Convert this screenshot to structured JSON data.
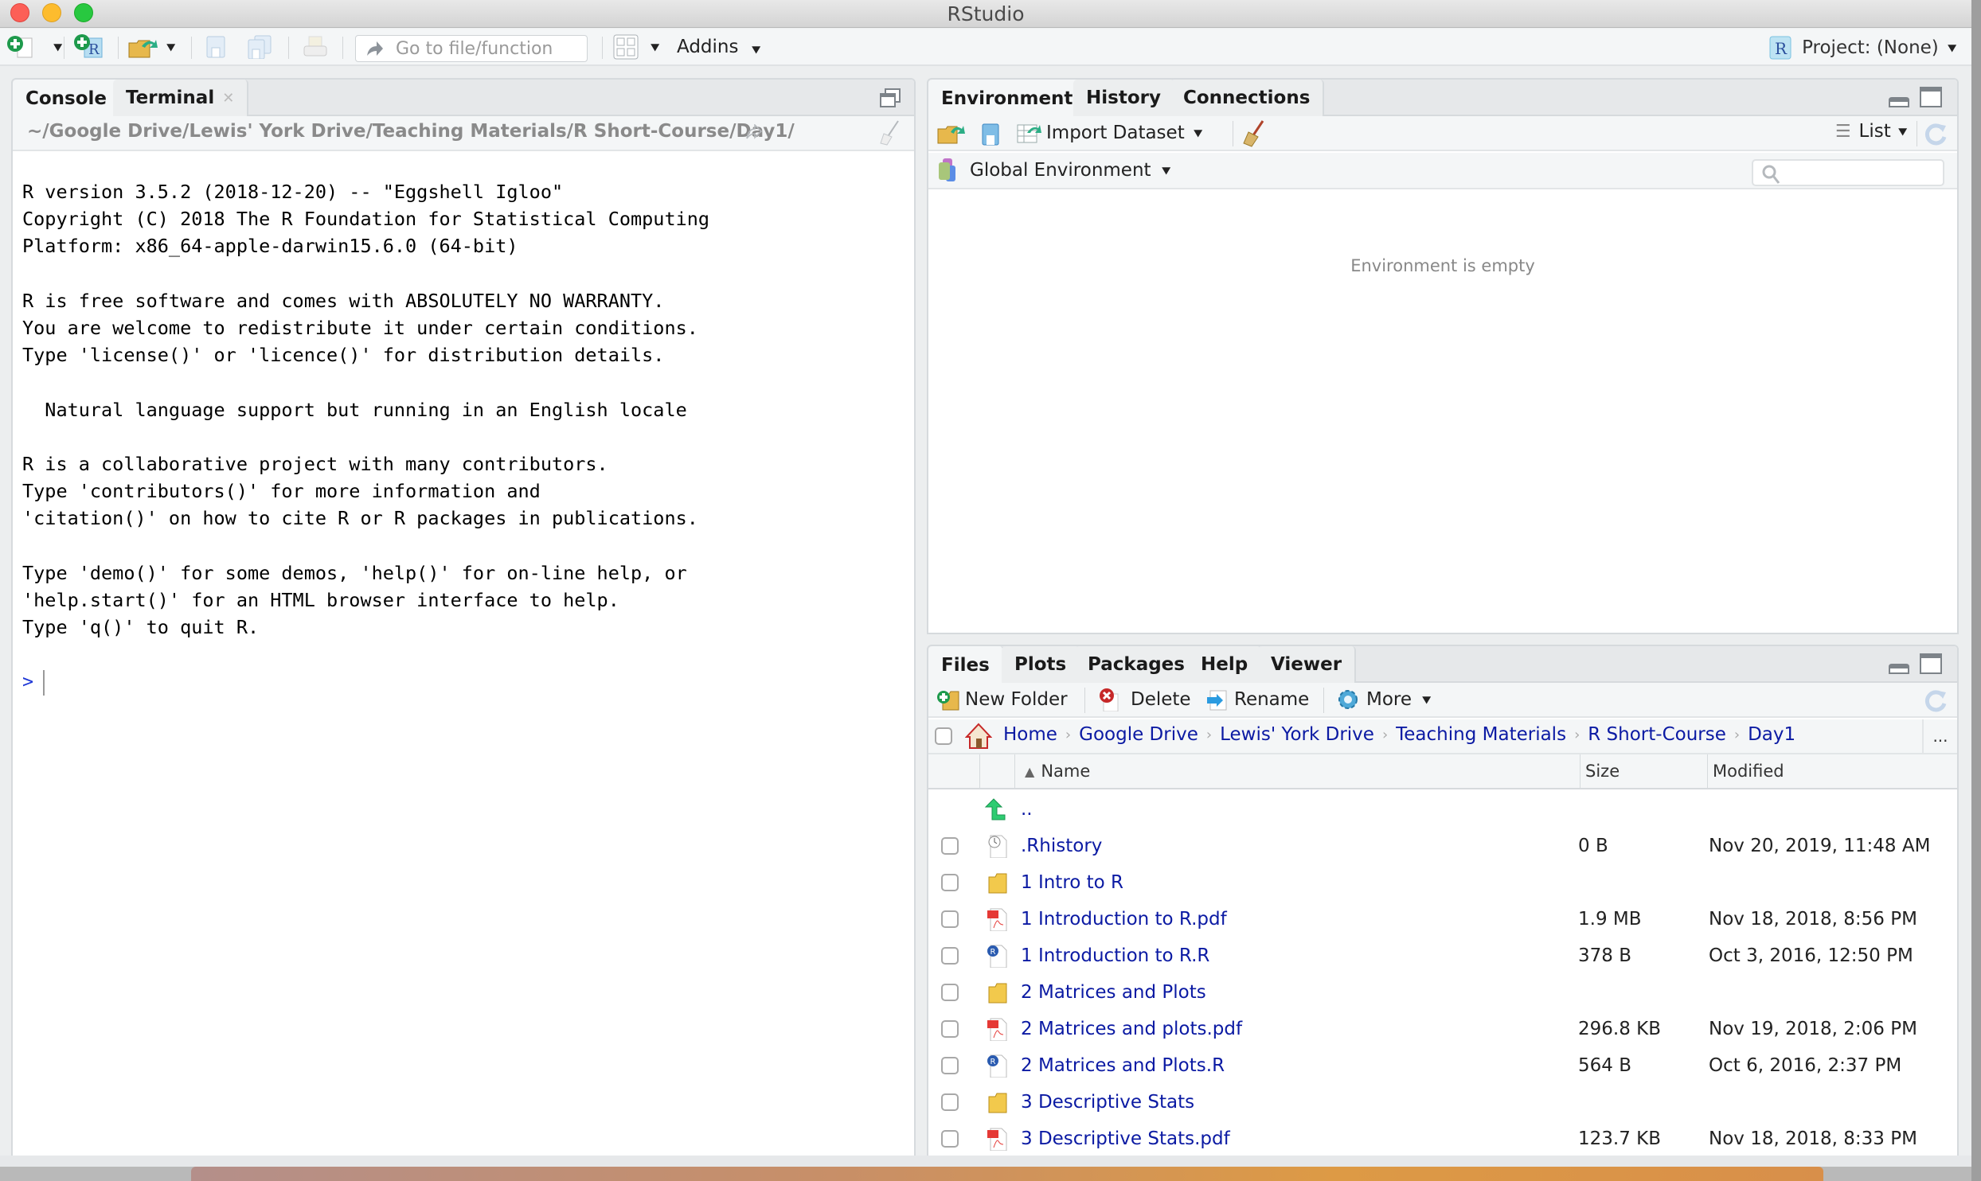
{
  "window": {
    "title": "RStudio"
  },
  "toolbar": {
    "goto_placeholder": "Go to file/function",
    "addins_label": "Addins",
    "project_label": "Project: (None)"
  },
  "console_pane": {
    "tabs": [
      {
        "label": "Console",
        "active": true
      },
      {
        "label": "Terminal",
        "closable": true
      }
    ],
    "working_dir": "~/Google Drive/Lewis' York Drive/Teaching Materials/R Short-Course/Day1/",
    "output_lines": [
      "R version 3.5.2 (2018-12-20) -- \"Eggshell Igloo\"",
      "Copyright (C) 2018 The R Foundation for Statistical Computing",
      "Platform: x86_64-apple-darwin15.6.0 (64-bit)",
      "",
      "R is free software and comes with ABSOLUTELY NO WARRANTY.",
      "You are welcome to redistribute it under certain conditions.",
      "Type 'license()' or 'licence()' for distribution details.",
      "",
      "  Natural language support but running in an English locale",
      "",
      "R is a collaborative project with many contributors.",
      "Type 'contributors()' for more information and",
      "'citation()' on how to cite R or R packages in publications.",
      "",
      "Type 'demo()' for some demos, 'help()' for on-line help, or",
      "'help.start()' for an HTML browser interface to help.",
      "Type 'q()' to quit R."
    ],
    "prompt": ">"
  },
  "env_pane": {
    "tabs": [
      {
        "label": "Environment",
        "active": true
      },
      {
        "label": "History"
      },
      {
        "label": "Connections"
      }
    ],
    "import_label": "Import Dataset",
    "view_mode": "List",
    "scope": "Global Environment",
    "search_placeholder": "",
    "empty_message": "Environment is empty"
  },
  "files_pane": {
    "tabs": [
      {
        "label": "Files",
        "active": true
      },
      {
        "label": "Plots"
      },
      {
        "label": "Packages"
      },
      {
        "label": "Help"
      },
      {
        "label": "Viewer"
      }
    ],
    "actions": {
      "new_folder": "New Folder",
      "delete": "Delete",
      "rename": "Rename",
      "more": "More"
    },
    "breadcrumb": [
      "Home",
      "Google Drive",
      "Lewis' York Drive",
      "Teaching Materials",
      "R Short-Course",
      "Day1"
    ],
    "breadcrumb_more": "...",
    "columns": {
      "name": "Name",
      "size": "Size",
      "modified": "Modified",
      "sort_indicator": "▲"
    },
    "parent_link": "..",
    "rows": [
      {
        "type": "history",
        "name": ".Rhistory",
        "size": "0 B",
        "modified": "Nov 20, 2019, 11:48 AM"
      },
      {
        "type": "folder",
        "name": "1 Intro to R",
        "size": "",
        "modified": ""
      },
      {
        "type": "pdf",
        "name": "1 Introduction to R.pdf",
        "size": "1.9 MB",
        "modified": "Nov 18, 2018, 8:56 PM"
      },
      {
        "type": "r",
        "name": "1 Introduction to R.R",
        "size": "378 B",
        "modified": "Oct 3, 2016, 12:50 PM"
      },
      {
        "type": "folder",
        "name": "2 Matrices and Plots",
        "size": "",
        "modified": ""
      },
      {
        "type": "pdf",
        "name": "2 Matrices and plots.pdf",
        "size": "296.8 KB",
        "modified": "Nov 19, 2018, 2:06 PM"
      },
      {
        "type": "r",
        "name": "2 Matrices and Plots.R",
        "size": "564 B",
        "modified": "Oct 6, 2016, 2:37 PM"
      },
      {
        "type": "folder",
        "name": "3 Descriptive Stats",
        "size": "",
        "modified": ""
      },
      {
        "type": "pdf",
        "name": "3 Descriptive Stats.pdf",
        "size": "123.7 KB",
        "modified": "Nov 18, 2018, 8:33 PM"
      }
    ]
  },
  "colors": {
    "link_blue": "#0b1aa3",
    "prompt_blue": "#1f38d6",
    "pane_border": "#d6dadd",
    "tab_bg": "#e6e8ea"
  }
}
